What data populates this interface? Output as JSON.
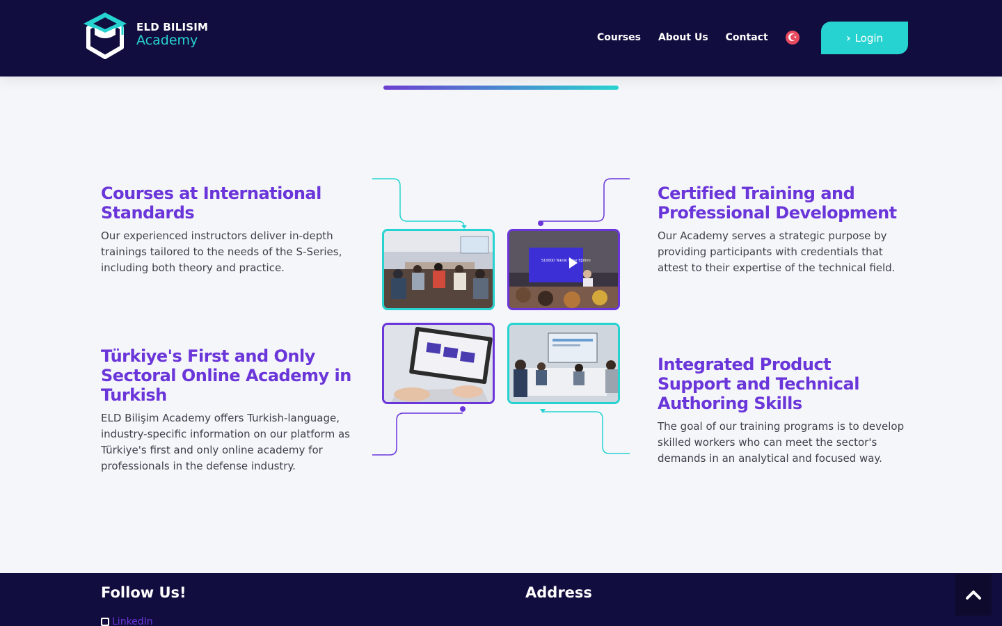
{
  "header": {
    "logo_line1": "ELD BILISIM",
    "logo_line2": "Academy",
    "nav": [
      "Courses",
      "About Us",
      "Contact"
    ],
    "login_label": "Login"
  },
  "features": [
    {
      "title": "Courses at International Standards",
      "text": "Our experienced instructors deliver in-depth trainings tailored to the needs of the S-Series, including both theory and practice."
    },
    {
      "title": "Certified Training and Professional Development",
      "text": "Our Academy serves a strategic purpose by providing participants with credentials that attest to their expertise of the technical field."
    },
    {
      "title": "Türkiye's First and Only Sectoral Online Academy in Turkish",
      "text": "ELD Bilişim Academy offers Turkish-language, industry-specific information on our platform as Türkiye's first and only online academy for professionals in the defense industry."
    },
    {
      "title": "Integrated Product Support and Technical Authoring Skills",
      "text": "The goal of our training programs is to develop skilled workers who can meet the sector's demands in an analytical and focused way."
    }
  ],
  "photos": {
    "p2_caption": "S1000D Teknik Yazar Eğitimi"
  },
  "footer": {
    "follow_title": "Follow Us!",
    "address_title": "Address",
    "linkedin_label": "LinkedIn"
  },
  "colors": {
    "navy": "#120d3f",
    "purple": "#6a35d9",
    "teal": "#27d3d0",
    "background": "#f4f6fa"
  },
  "icons": [
    "logo-hexagon-mortarboard",
    "turkey-flag",
    "chevron-right",
    "linkedin",
    "chevron-up"
  ]
}
